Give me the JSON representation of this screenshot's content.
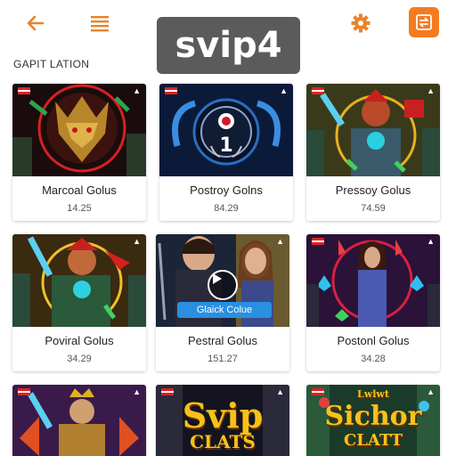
{
  "header": {
    "brand": "svip4",
    "back_icon": "arrow-left-icon",
    "menu_icon": "hamburger-menu-icon",
    "settings_icon": "gear-icon",
    "action_icon": "exchange-icon",
    "accent_color": "#f47b20"
  },
  "section": {
    "title": "GAPIT LATION"
  },
  "games": [
    {
      "name": "Marcoal Golus",
      "price": "14.25"
    },
    {
      "name": "Postroy Golns",
      "price": "84.29"
    },
    {
      "name": "Pressoy Golus",
      "price": "74.59"
    },
    {
      "name": "Poviral Golus",
      "price": "34.29"
    },
    {
      "name": "Pestral Golus",
      "price": "151.27",
      "overlay_label": "Glaick Colue"
    },
    {
      "name": "Postonl Golus",
      "price": "34.28"
    },
    {
      "name": "",
      "price": ""
    },
    {
      "name": "",
      "price": "",
      "thumb_line1": "Svip",
      "thumb_line2": "CLATS"
    },
    {
      "name": "",
      "price": "",
      "thumb_line0": "Lwlwt",
      "thumb_line1": "Sichor",
      "thumb_line2": "CLATT"
    }
  ]
}
